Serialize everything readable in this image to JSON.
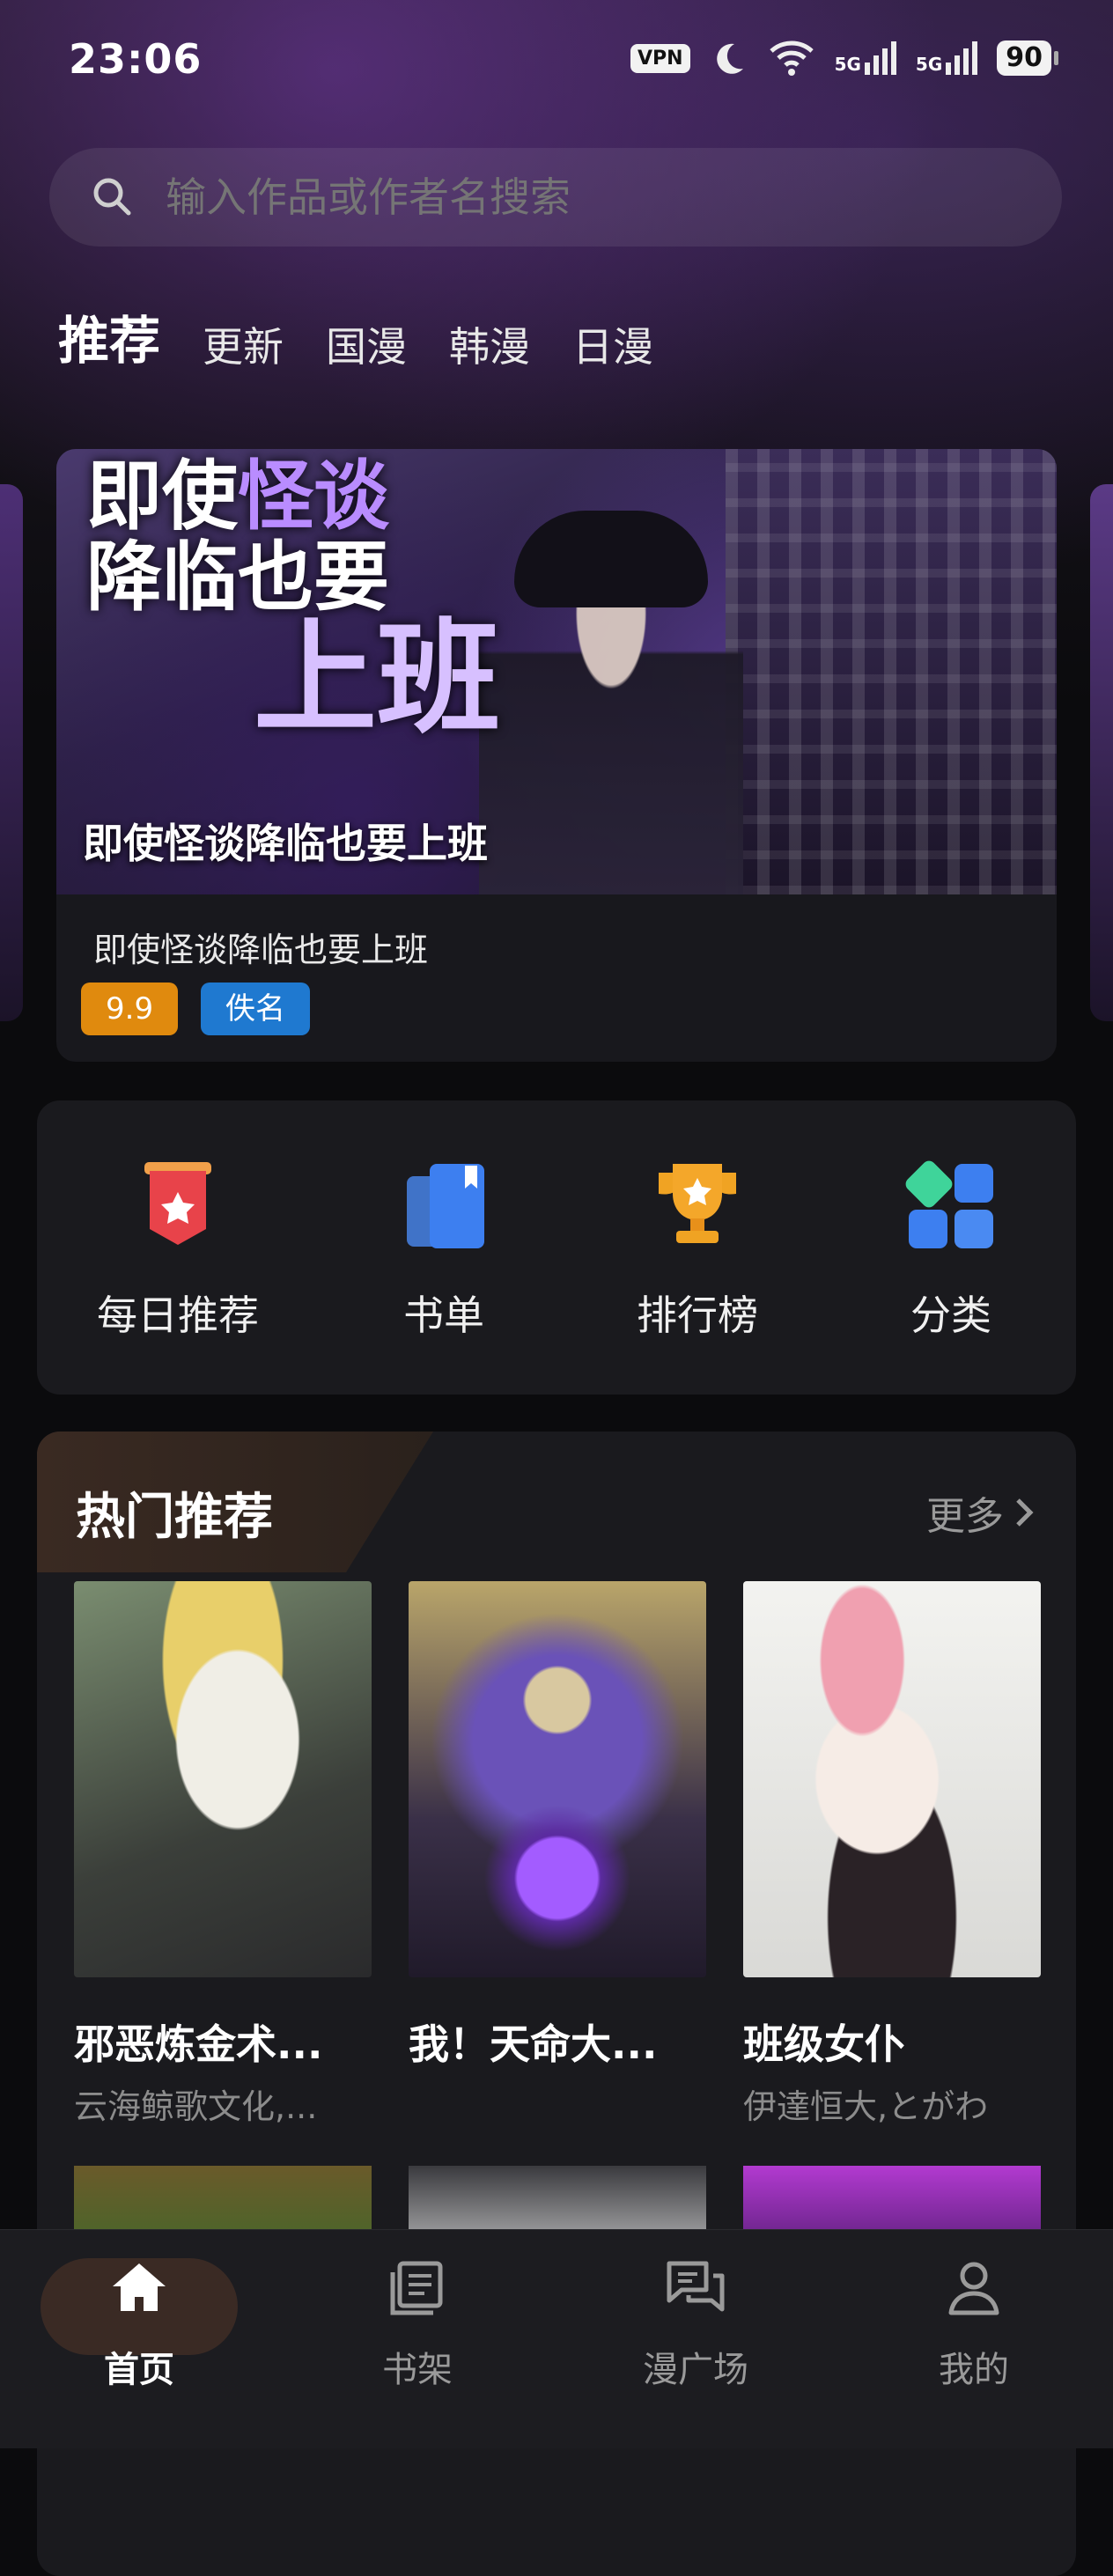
{
  "status_bar": {
    "time": "23:06",
    "vpn": "VPN",
    "net1": "5G",
    "net2": "5G",
    "battery": "90"
  },
  "search": {
    "placeholder": "输入作品或作者名搜索",
    "icon": "search-icon"
  },
  "tabs": [
    {
      "label": "推荐",
      "active": true
    },
    {
      "label": "更新"
    },
    {
      "label": "国漫"
    },
    {
      "label": "韩漫"
    },
    {
      "label": "日漫"
    }
  ],
  "banner": {
    "headline_line1_a": "即使",
    "headline_line1_b": "怪谈",
    "headline_line2": "降临也要",
    "headline_line3": "上班",
    "overlay_title": "即使怪谈降临也要上班",
    "name": "即使怪谈降临也要上班",
    "score": "9.9",
    "author": "佚名"
  },
  "quick_entries": [
    {
      "label": "每日推荐",
      "icon": "daily-recommend-icon",
      "color": "#e8434a"
    },
    {
      "label": "书单",
      "icon": "booklist-icon",
      "color": "#3d7ff0"
    },
    {
      "label": "排行榜",
      "icon": "trophy-icon",
      "color": "#f0a323"
    },
    {
      "label": "分类",
      "icon": "category-icon",
      "color": "#3d7ff0"
    }
  ],
  "hot": {
    "title": "热门推荐",
    "more": "更多",
    "items": [
      {
        "title": "邪恶炼金术...",
        "author": "云海鲸歌文化,..."
      },
      {
        "title": "我！天命大...",
        "author": ""
      },
      {
        "title": "班级女仆",
        "author": "伊達恒大,とがわ"
      }
    ]
  },
  "bottom_nav": [
    {
      "label": "首页",
      "icon": "home-icon",
      "active": true
    },
    {
      "label": "书架",
      "icon": "bookshelf-icon"
    },
    {
      "label": "漫广场",
      "icon": "comic-square-icon"
    },
    {
      "label": "我的",
      "icon": "profile-icon"
    }
  ],
  "colors": {
    "accent": "#ff6a3d",
    "score_tag": "#e08a0e",
    "author_tag": "#1f79d0"
  }
}
